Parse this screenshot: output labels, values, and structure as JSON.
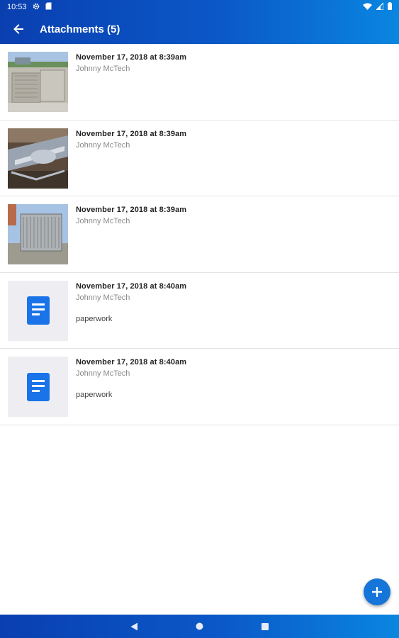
{
  "status_bar": {
    "time": "10:53"
  },
  "app_bar": {
    "title": "Attachments (5)"
  },
  "attachments": [
    {
      "date": "November 17, 2018 at 8:39am",
      "author": "Johnny McTech",
      "note": "",
      "kind": "photo-rooftop-unit"
    },
    {
      "date": "November 17, 2018 at 8:39am",
      "author": "Johnny McTech",
      "note": "",
      "kind": "photo-unit-interior"
    },
    {
      "date": "November 17, 2018 at 8:39am",
      "author": "Johnny McTech",
      "note": "",
      "kind": "photo-unit-coil"
    },
    {
      "date": "November 17, 2018 at 8:40am",
      "author": "Johnny McTech",
      "note": "paperwork",
      "kind": "document"
    },
    {
      "date": "November 17, 2018 at 8:40am",
      "author": "Johnny McTech",
      "note": "paperwork",
      "kind": "document"
    }
  ],
  "colors": {
    "accent": "#1675d8",
    "app_bar_start": "#0a3fb0",
    "app_bar_end": "#0a86e0"
  }
}
